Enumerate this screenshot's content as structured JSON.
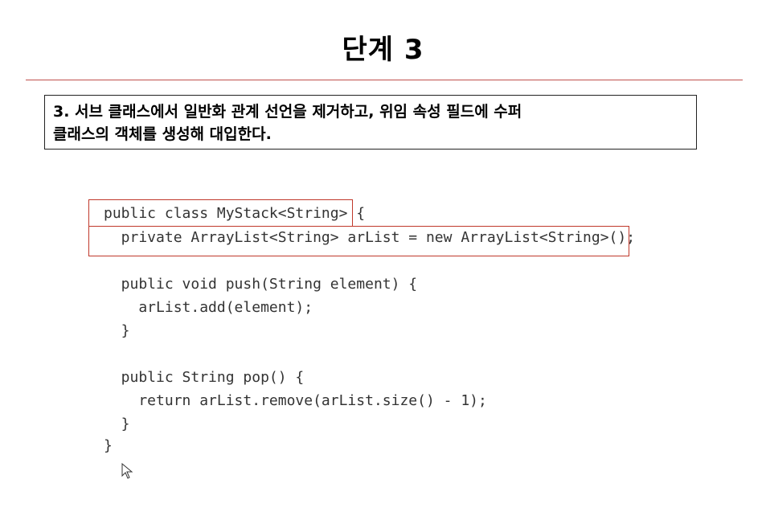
{
  "slide": {
    "title": "단계 3",
    "description_lines": [
      "3. 서브 클래스에서 일반화 관계 선언을 제거하고, 위임 속성 필드에 수퍼",
      "클래스의 객체를 생성해 대입한다."
    ]
  },
  "code": {
    "lines": [
      "public class MyStack<String> {",
      "  private ArrayList<String> arList = new ArrayList<String>();",
      "",
      "  public void push(String element) {",
      "    arList.add(element);",
      "  }",
      "",
      "  public String pop() {",
      "    return arList.remove(arList.size() - 1);",
      "  }",
      "}"
    ]
  },
  "colors": {
    "rule": "#c0504d",
    "highlight": "#c0392b"
  },
  "icons": {
    "cursor": "mouse-pointer-icon"
  }
}
